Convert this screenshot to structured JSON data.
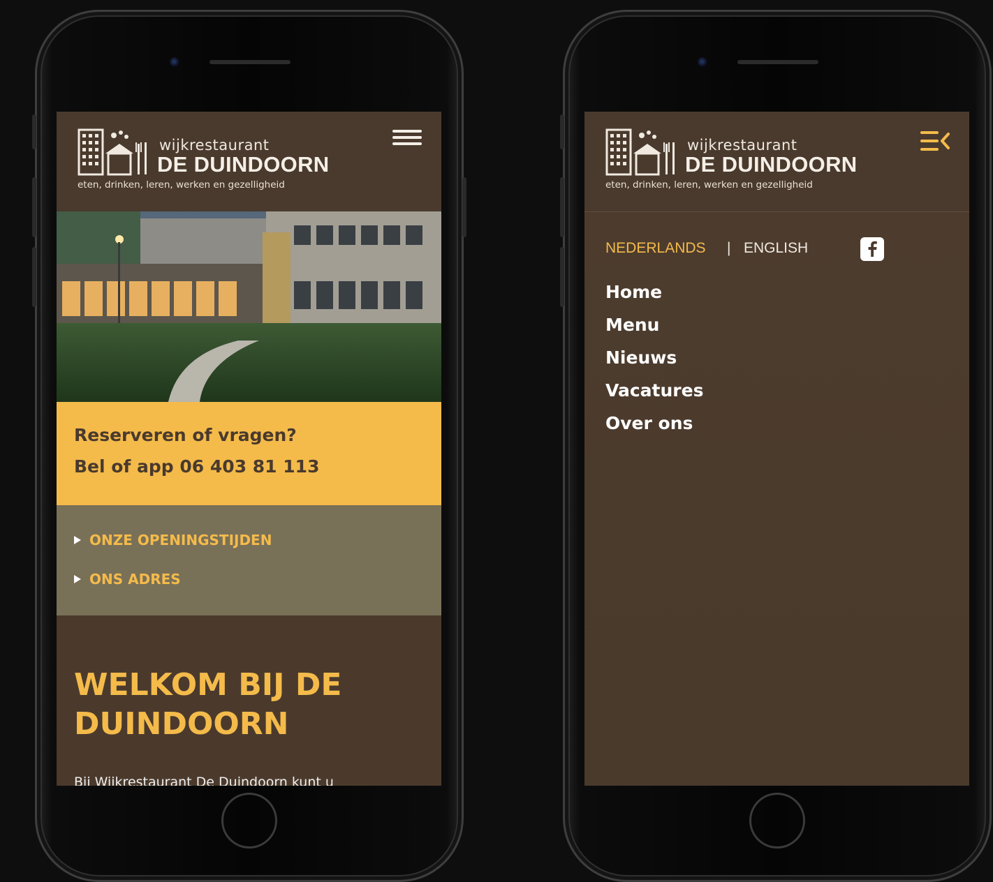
{
  "colors": {
    "brand_brown": "#4a3a2d",
    "accent_yellow": "#f4bb4b",
    "accordion_bg": "#797058",
    "text_light": "#f4efe7",
    "background": "#0e0e0e"
  },
  "logo": {
    "small": "wijkrestaurant",
    "big": "DE DUINDOORN",
    "tagline": "eten, drinken, leren, werken en gezelligheid"
  },
  "left_phone": {
    "menu_icon": "hamburger-icon",
    "hero_image": "restaurant-building-photo",
    "callout": {
      "line1": "Reserveren of vragen?",
      "line2": "Bel of app 06 403 81 113"
    },
    "accordion": [
      {
        "label": "ONZE OPENINGSTIJDEN",
        "icon": "triangle-right-icon"
      },
      {
        "label": "ONS ADRES",
        "icon": "triangle-right-icon"
      }
    ],
    "welcome": {
      "heading": "WELKOM BIJ DE DUINDOORN",
      "intro": "Bij Wijkrestaurant De Duindoorn kunt u"
    }
  },
  "right_phone": {
    "menu_icon": "menu-close-icon",
    "languages": {
      "active": "NEDERLANDS",
      "separator": "|",
      "other": "ENGLISH"
    },
    "social_icon": "facebook-icon",
    "nav": [
      "Home",
      "Menu",
      "Nieuws",
      "Vacatures",
      "Over ons"
    ]
  }
}
